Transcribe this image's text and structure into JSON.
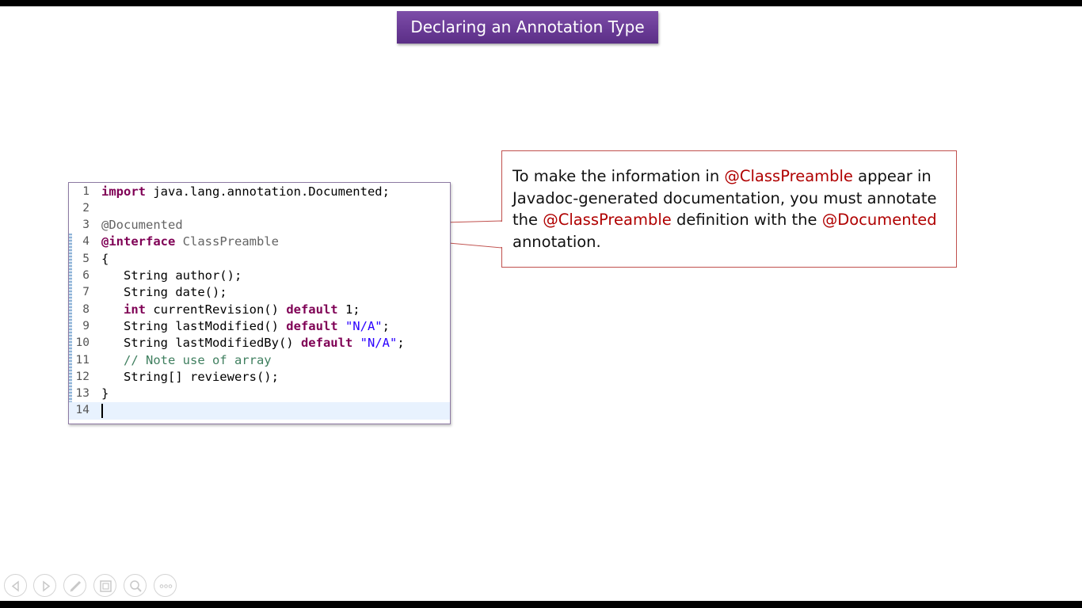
{
  "slide": {
    "title": "Declaring an Annotation Type"
  },
  "code_editor": {
    "lines": [
      {
        "num": "1",
        "tokens": [
          {
            "t": "import",
            "c": "kw"
          },
          {
            "t": " java.lang.annotation.Documented;",
            "c": ""
          }
        ]
      },
      {
        "num": "2",
        "tokens": []
      },
      {
        "num": "3",
        "tokens": [
          {
            "t": "@Documented",
            "c": "ann"
          }
        ]
      },
      {
        "num": "4",
        "tokens": [
          {
            "t": "@interface",
            "c": "kw"
          },
          {
            "t": " ClassPreamble",
            "c": "ann"
          }
        ]
      },
      {
        "num": "5",
        "tokens": [
          {
            "t": "{",
            "c": ""
          }
        ]
      },
      {
        "num": "6",
        "tokens": [
          {
            "t": "   String author();",
            "c": ""
          }
        ]
      },
      {
        "num": "7",
        "tokens": [
          {
            "t": "   String date();",
            "c": ""
          }
        ]
      },
      {
        "num": "8",
        "tokens": [
          {
            "t": "   ",
            "c": ""
          },
          {
            "t": "int",
            "c": "kw"
          },
          {
            "t": " currentRevision() ",
            "c": ""
          },
          {
            "t": "default",
            "c": "kw"
          },
          {
            "t": " 1;",
            "c": ""
          }
        ]
      },
      {
        "num": "9",
        "tokens": [
          {
            "t": "   String lastModified() ",
            "c": ""
          },
          {
            "t": "default",
            "c": "kw"
          },
          {
            "t": " ",
            "c": ""
          },
          {
            "t": "\"N/A\"",
            "c": "str"
          },
          {
            "t": ";",
            "c": ""
          }
        ]
      },
      {
        "num": "10",
        "tokens": [
          {
            "t": "   String lastModifiedBy() ",
            "c": ""
          },
          {
            "t": "default",
            "c": "kw"
          },
          {
            "t": " ",
            "c": ""
          },
          {
            "t": "\"N/A\"",
            "c": "str"
          },
          {
            "t": ";",
            "c": ""
          }
        ]
      },
      {
        "num": "11",
        "tokens": [
          {
            "t": "   // Note use of array",
            "c": "cmt"
          }
        ]
      },
      {
        "num": "12",
        "tokens": [
          {
            "t": "   String[] reviewers();",
            "c": ""
          }
        ]
      },
      {
        "num": "13",
        "tokens": [
          {
            "t": "}",
            "c": ""
          }
        ]
      },
      {
        "num": "14",
        "tokens": [],
        "current": true
      }
    ]
  },
  "callout": {
    "segments": [
      {
        "t": "To make the information in ",
        "hl": false
      },
      {
        "t": "@ClassPreamble",
        "hl": true
      },
      {
        "t": " appear in Javadoc-generated documentation, you must annotate the ",
        "hl": false
      },
      {
        "t": "@ClassPreamble",
        "hl": true
      },
      {
        "t": " definition with the ",
        "hl": false
      },
      {
        "t": "@Documented",
        "hl": true
      },
      {
        "t": " annotation.",
        "hl": false
      }
    ],
    "highlight_color": "#b00000",
    "border_color": "#c0504d"
  },
  "theme": {
    "title_bar_color": "#6a3b96",
    "keyword_color": "#7f0055",
    "string_color": "#2a00ff",
    "comment_color": "#3f7f5f"
  },
  "toolbar": {
    "buttons": [
      {
        "name": "previous-slide-button",
        "icon": "arrow-left-icon"
      },
      {
        "name": "next-slide-button",
        "icon": "arrow-right-icon"
      },
      {
        "name": "pen-button",
        "icon": "pen-icon"
      },
      {
        "name": "see-all-slides-button",
        "icon": "slides-grid-icon"
      },
      {
        "name": "zoom-button",
        "icon": "magnifier-icon"
      },
      {
        "name": "more-options-button",
        "icon": "ellipsis-icon"
      }
    ]
  }
}
